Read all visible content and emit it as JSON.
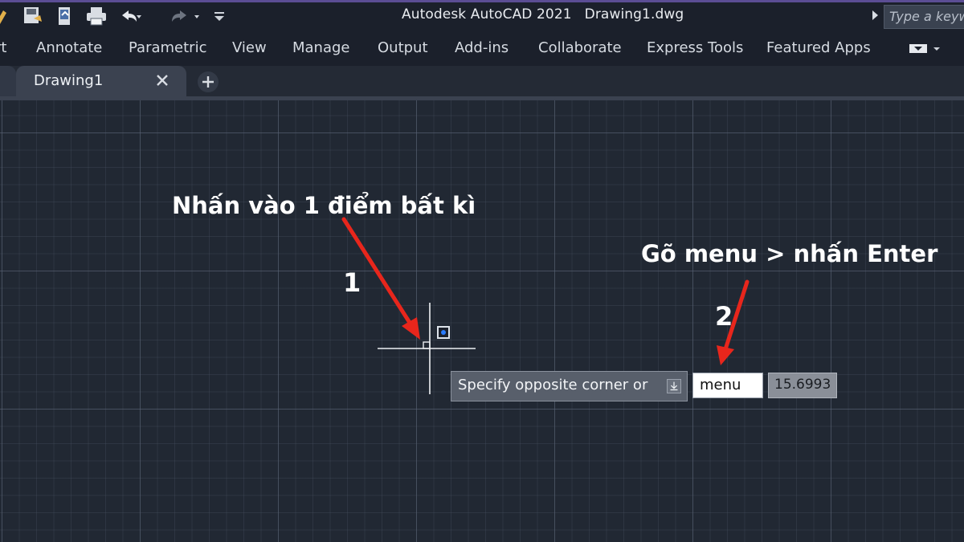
{
  "window": {
    "app_title": "Autodesk AutoCAD 2021",
    "file_name": "Drawing1.dwg",
    "search_placeholder": "Type a keyw"
  },
  "ribbon": {
    "tabs": [
      "rt",
      "Annotate",
      "Parametric",
      "View",
      "Manage",
      "Output",
      "Add-ins",
      "Collaborate",
      "Express Tools",
      "Featured Apps"
    ]
  },
  "file_tabs": {
    "active_label": "Drawing1",
    "close_glyph": "×",
    "new_tab_glyph": "+"
  },
  "annotations": {
    "step1_text": "Nhấn vào 1 điểm bất kì",
    "step2_text": "Gõ menu > nhấn Enter",
    "step1_number": "1",
    "step2_number": "2"
  },
  "dynamic_input": {
    "prompt": "Specify opposite corner or",
    "typed_value": "menu",
    "readout": "15.6993"
  },
  "icons": {
    "quick_access": [
      "edit-icon",
      "save-as-icon",
      "publish-icon",
      "plot-icon",
      "undo-icon",
      "redo-icon",
      "customize-icon"
    ],
    "dropdown_arrow": "chevron-down-icon"
  },
  "colors": {
    "background": "#212833",
    "annotation_arrow": "#e8261c",
    "annotation_text": "#ffffff",
    "snap_point": "#2a7cff",
    "accent_border": "#5b4d94"
  }
}
